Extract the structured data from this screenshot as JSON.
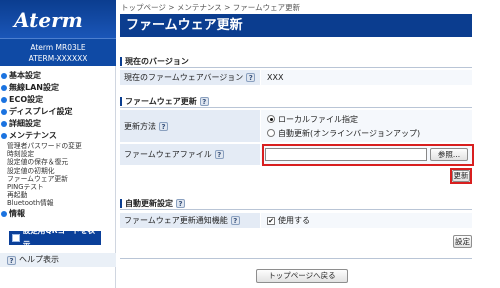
{
  "sidebar": {
    "logo": "Aterm",
    "model_line1": "Aterm MR03LE",
    "model_line2": "ATERM-XXXXXX",
    "menu": [
      {
        "label": "基本設定"
      },
      {
        "label": "無線LAN設定"
      },
      {
        "label": "ECO設定"
      },
      {
        "label": "ディスプレイ設定"
      },
      {
        "label": "詳細設定"
      },
      {
        "label": "メンテナンス"
      }
    ],
    "subitems": [
      "管理者パスワードの変更",
      "時刻設定",
      "設定値の保存＆復元",
      "設定値の初期化",
      "ファームウェア更新",
      "PINGテスト",
      "再起動",
      "Bluetooth情報"
    ],
    "info_label": "情報",
    "qr_button": "設定用QRコードを表示",
    "help_label": "ヘルプ表示"
  },
  "main": {
    "breadcrumb": "トップページ > メンテナンス > ファームウェア更新",
    "title": "ファームウェア更新",
    "current_version": {
      "heading": "現在のバージョン",
      "label": "現在のファームウェアバージョン",
      "value": "XXX"
    },
    "update": {
      "heading": "ファームウェア更新",
      "method_label": "更新方法",
      "option_local": "ローカルファイル指定",
      "option_auto": "自動更新(オンラインバージョンアップ)",
      "file_label": "ファームウェアファイル",
      "file_value": "",
      "browse_button": "参照...",
      "update_button": "更新"
    },
    "auto": {
      "heading": "自動更新設定",
      "notify_label": "ファームウェア更新通知機能",
      "use_label": "使用する",
      "set_button": "設定"
    },
    "back_button": "トップページへ戻る"
  }
}
